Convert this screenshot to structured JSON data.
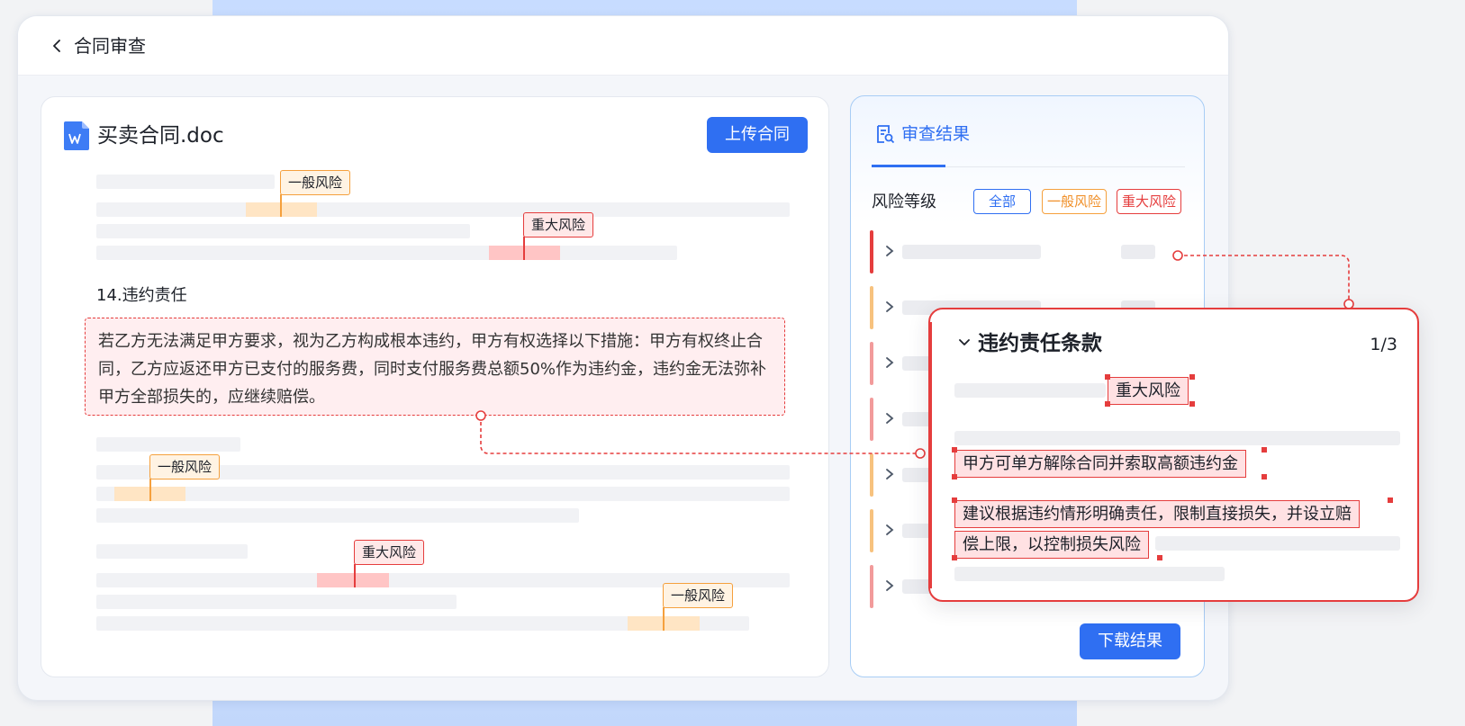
{
  "window": {
    "title": "合同审查"
  },
  "document": {
    "file_name": "买卖合同.doc",
    "upload_label": "上传合同",
    "section_heading": "14.违约责任",
    "clause_text": "若乙方无法满足甲方要求，视为乙方构成根本违约，甲方有权选择以下措施：甲方有权终止合同，乙方应返还甲方已支付的服务费，同时支付服务费总额50%作为违约金，违约金无法弥补甲方全部损失的，应继续赔偿。",
    "risk_tags": [
      {
        "label": "一般风险",
        "level": "general"
      },
      {
        "label": "重大风险",
        "level": "major"
      },
      {
        "label": "一般风险",
        "level": "general"
      },
      {
        "label": "重大风险",
        "level": "major"
      },
      {
        "label": "一般风险",
        "level": "general"
      }
    ]
  },
  "results": {
    "title": "审查结果",
    "risk_level_label": "风险等级",
    "filters": {
      "all": "全部",
      "general": "一般风险",
      "major": "重大风险"
    },
    "rows": [
      {
        "level": "major"
      },
      {
        "level": "general"
      },
      {
        "level": "major"
      },
      {
        "level": "major"
      },
      {
        "level": "general"
      },
      {
        "level": "general"
      },
      {
        "level": "major"
      }
    ],
    "download_label": "下载结果"
  },
  "popup": {
    "title": "违约责任条款",
    "count": "1/3",
    "risk_tag": "重大风险",
    "issue": "甲方可单方解除合同并索取高额违约金",
    "suggestion_line1": "建议根据违约情形明确责任，限制直接损失，并设立赔",
    "suggestion_line2": "偿上限，以控制损失风险"
  },
  "colors": {
    "primary": "#2f6ff2",
    "general_risk": "#f5a03d",
    "major_risk": "#e53d3d"
  },
  "icons": [
    "back-arrow-icon",
    "wps-doc-icon",
    "review-search-icon",
    "chevron-right-icon",
    "chevron-down-icon"
  ]
}
